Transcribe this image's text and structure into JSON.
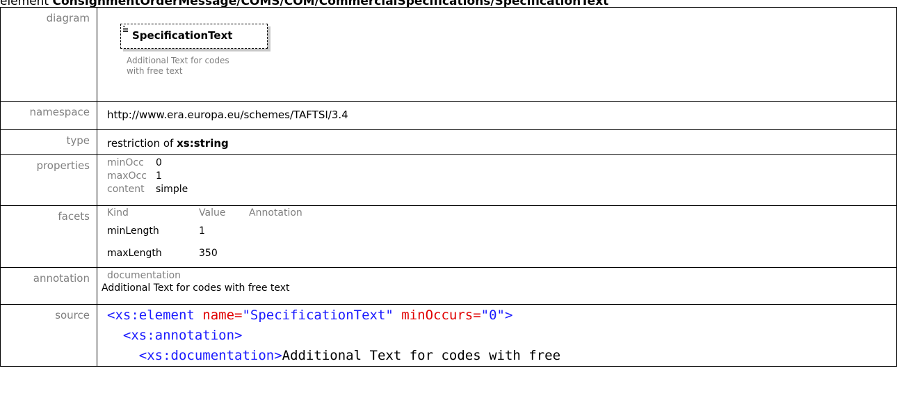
{
  "page": {
    "title_prefix": "element",
    "title_path": "ConsignmentOrderMessage/COMS/COM/CommercialSpecifications/SpecificationText"
  },
  "labels": {
    "diagram": "diagram",
    "namespace": "namespace",
    "type": "type",
    "properties": "properties",
    "facets": "facets",
    "annotation": "annotation",
    "source": "source"
  },
  "diagram": {
    "element_name": "SpecificationText",
    "caption": "Additional Text for codes with free text"
  },
  "namespace": {
    "value": "http://www.era.europa.eu/schemes/TAFTSI/3.4"
  },
  "type": {
    "prefix": "restriction of",
    "base": "xs:string"
  },
  "properties": {
    "rows": [
      {
        "key": "minOcc",
        "value": "0"
      },
      {
        "key": "maxOcc",
        "value": "1"
      },
      {
        "key": "content",
        "value": "simple"
      }
    ]
  },
  "facets": {
    "headers": [
      "Kind",
      "Value",
      "Annotation"
    ],
    "rows": [
      {
        "kind": "minLength",
        "value": "1",
        "annotation": ""
      },
      {
        "kind": "maxLength",
        "value": "350",
        "annotation": ""
      }
    ]
  },
  "annotation": {
    "label": "documentation",
    "text": "Additional Text for codes with free text"
  },
  "source": {
    "line1": {
      "open": "<xs:element",
      "attr1": " name=",
      "val1": "\"SpecificationText\"",
      "attr2": " minOccurs=",
      "val2": "\"0\"",
      "close": ">"
    },
    "line2": "  <xs:annotation>",
    "line3": {
      "open": "    <xs:documentation>",
      "text": "Additional Text for codes with free"
    }
  },
  "colors": {
    "label_gray": "#808080",
    "xml_tag": "#1a1aff",
    "xml_attr": "#e00000"
  }
}
